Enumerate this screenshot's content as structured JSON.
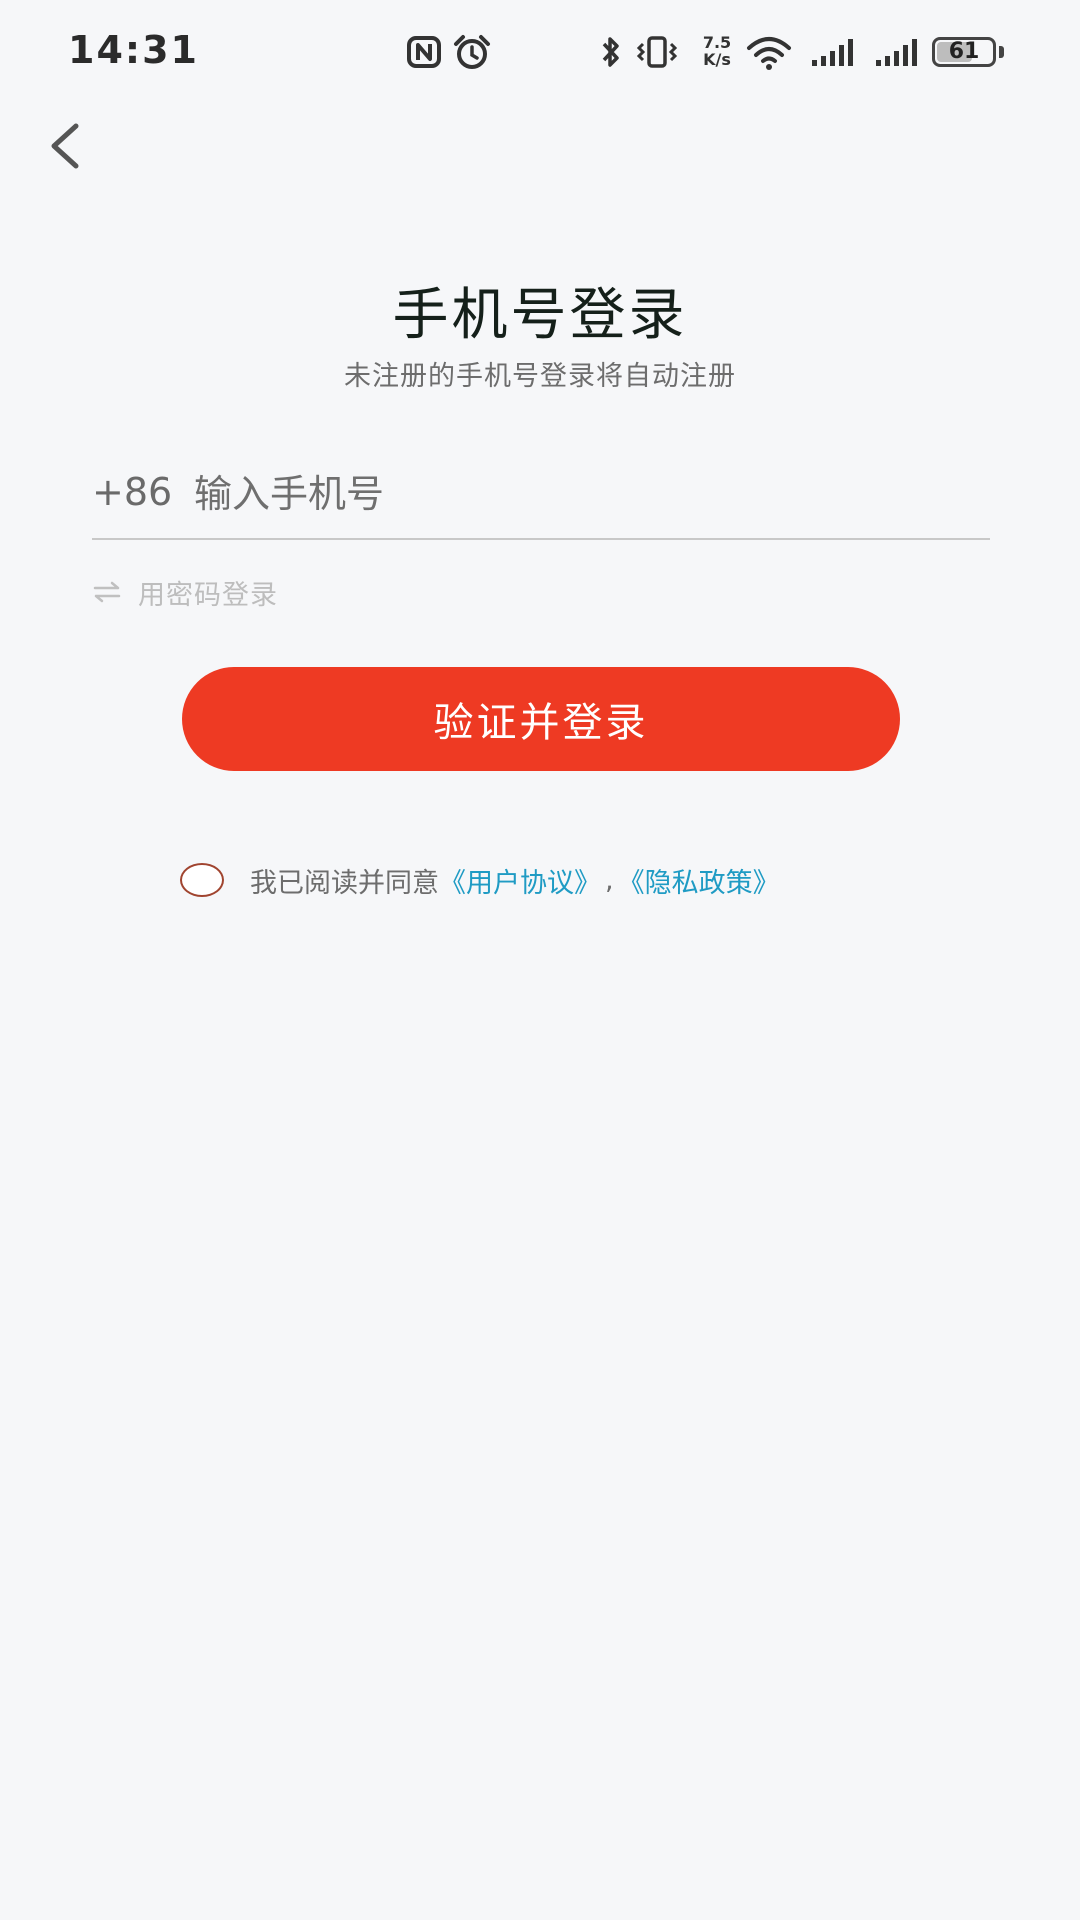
{
  "status_bar": {
    "time": "14:31",
    "net_speed_value": "7.5",
    "net_speed_unit": "K/s",
    "battery_percent": "61",
    "icons": [
      "nfc-icon",
      "alarm-icon",
      "bluetooth-icon",
      "vibrate-icon",
      "wifi-icon",
      "signal-icon",
      "signal-icon-2",
      "battery-icon"
    ]
  },
  "header": {
    "back_icon": "chevron-left-icon",
    "title": "手机号登录",
    "subtitle": "未注册的手机号登录将自动注册"
  },
  "form": {
    "country_code": "+86",
    "phone_placeholder": "输入手机号",
    "phone_value": "",
    "password_login_label": "用密码登录",
    "submit_label": "验证并登录"
  },
  "agreement": {
    "checked": false,
    "text": "我已阅读并同意",
    "user_agreement": "《用户协议》",
    "separator": ",",
    "privacy_policy": "《隐私政策》"
  },
  "colors": {
    "background": "#f6f7f9",
    "primary": "#ee3a23",
    "link": "#1f9bc4",
    "checkbox_border": "#a0442f"
  }
}
